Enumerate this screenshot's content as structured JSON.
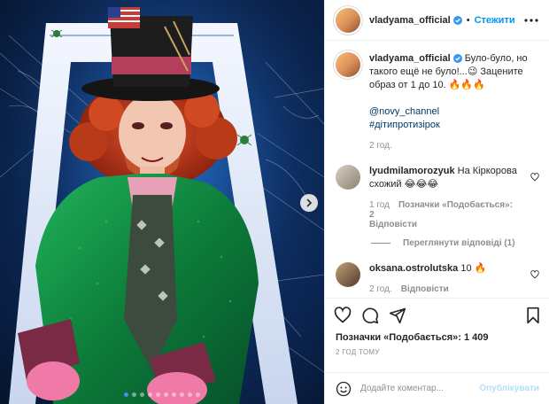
{
  "post": {
    "username": "vladyama_official",
    "follow_label": "Стежити",
    "more_icon": "more-horizontal-icon",
    "caption": {
      "line1": "Було-було, но такого ещё не було!...",
      "emoji1": "😉",
      "line2": "Зацените образ от 1 до 10.",
      "emoji2": "🔥🔥🔥",
      "mention": "@novy_channel",
      "hashtag": "#дітипротизірок",
      "time": "2 год."
    },
    "comments": [
      {
        "username": "lyudmilamorozyuk",
        "text": "На Кіркорова схожий",
        "emoji": "😂😂😂",
        "time": "1 год",
        "likes": "Позначки «Подобається»: 2",
        "reply_label": "Відповісти",
        "view_replies": "Переглянути відповіді (1)"
      },
      {
        "username": "oksana.ostrolutska",
        "text": "10",
        "emoji": "🔥",
        "time": "2 год.",
        "reply_label": "Відповісти"
      }
    ],
    "likes_text": "Позначки «Подобається»: 1 409",
    "posted_ago": "2 ГОД ТОМУ",
    "add_comment": {
      "placeholder": "Додайте коментар...",
      "post_label": "Опублікувати"
    },
    "carousel": {
      "total": 10,
      "active_index": 0
    }
  },
  "colors": {
    "accent": "#0095f6",
    "link": "#00376b",
    "muted": "#8e8e8e",
    "text": "#262626",
    "post_disabled": "#b2dffc"
  }
}
